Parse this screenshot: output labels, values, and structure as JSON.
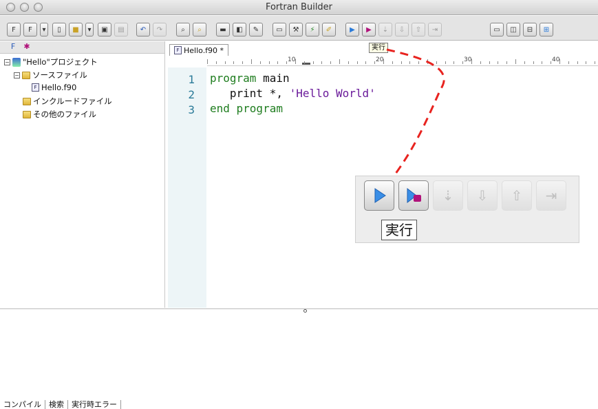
{
  "window": {
    "title": "Fortran Builder"
  },
  "toolbar": {
    "icons": [
      "new-project-icon",
      "open-project-icon",
      "dropdown-icon",
      "new-file-icon",
      "open-file-icon",
      "dropdown-icon",
      "save-icon",
      "print-icon",
      "undo-icon",
      "redo-icon",
      "find-icon",
      "replace-icon",
      "compile-icon",
      "build-icon",
      "options-icon",
      "window-icon",
      "tools-icon",
      "wand-icon",
      "broom-icon",
      "run-icon",
      "debug-run-icon",
      "step-over-icon",
      "step-into-icon",
      "step-out-icon",
      "run-to-cursor-icon",
      "layout-single-icon",
      "layout-vertical-icon",
      "layout-horizontal-icon",
      "layout-grid-icon"
    ]
  },
  "project_tree": {
    "items": [
      {
        "label": "\"Hello\"プロジェクト",
        "type": "project"
      },
      {
        "label": "ソースファイル",
        "type": "folder"
      },
      {
        "label": "Hello.f90",
        "type": "file"
      },
      {
        "label": "インクルードファイル",
        "type": "folder"
      },
      {
        "label": "その他のファイル",
        "type": "folder"
      }
    ]
  },
  "editor": {
    "tab_label": "Hello.f90 *",
    "ruler_marks": [
      "10",
      "20",
      "30",
      "40"
    ],
    "lines": [
      {
        "num": "1",
        "kw": "program",
        "rest": " main",
        "str": ""
      },
      {
        "num": "2",
        "kw": "",
        "rest": "   print *, ",
        "str": "'Hello World'"
      },
      {
        "num": "3",
        "kw": "end program",
        "rest": "",
        "str": ""
      }
    ]
  },
  "tooltip": {
    "label": "実行"
  },
  "zoom": {
    "tooltip_label": "実行"
  },
  "bottom_tabs": [
    "コンパイル",
    "検索",
    "実行時エラー"
  ],
  "colors": {
    "keyword": "#1f7d1f",
    "string": "#6a1a9a",
    "line_number": "#2a7a98",
    "callout": "#e8231f"
  }
}
